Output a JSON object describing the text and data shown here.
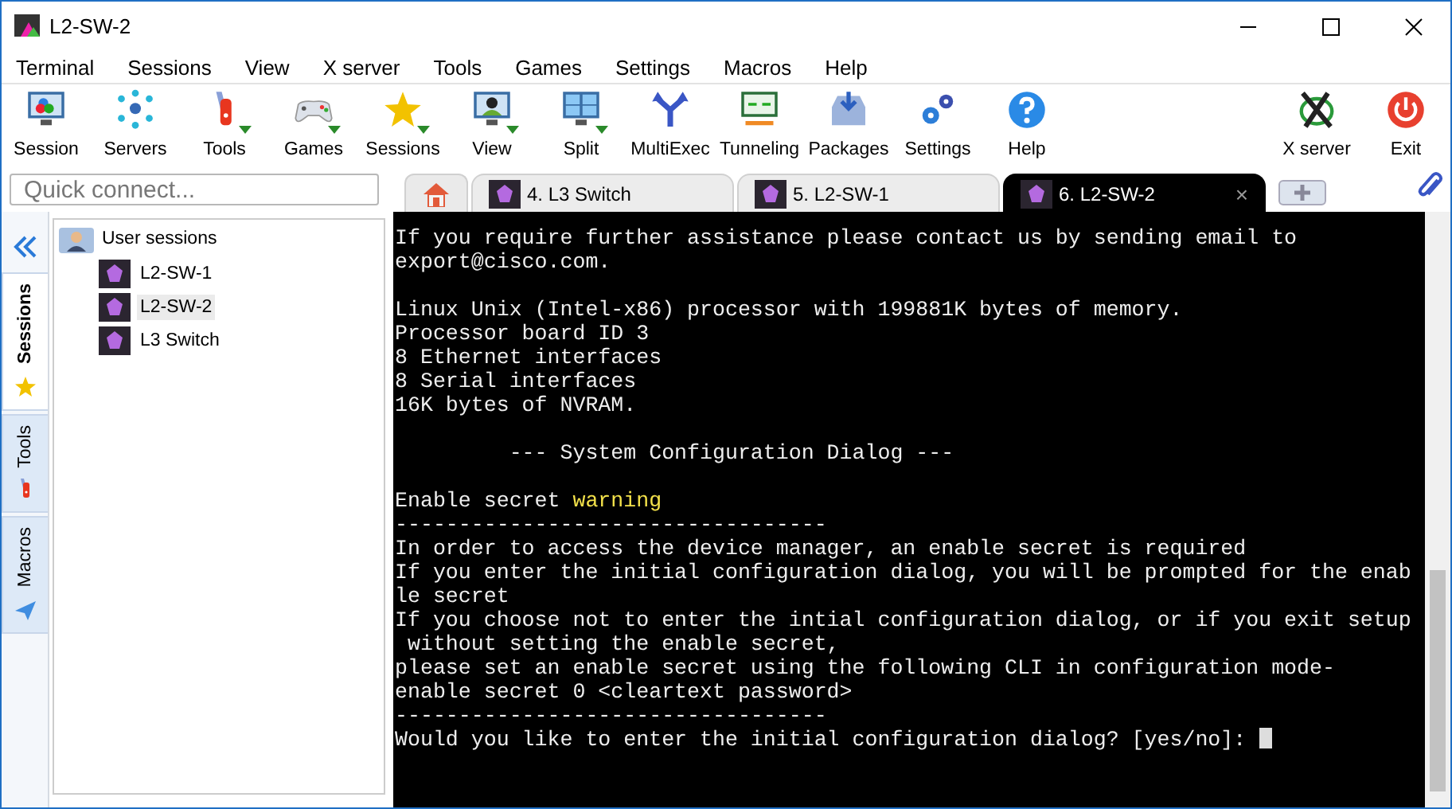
{
  "window": {
    "title": "L2-SW-2"
  },
  "menu": [
    "Terminal",
    "Sessions",
    "View",
    "X server",
    "Tools",
    "Games",
    "Settings",
    "Macros",
    "Help"
  ],
  "toolbar": [
    {
      "label": "Session",
      "kind": "session",
      "dropdown": false
    },
    {
      "label": "Servers",
      "kind": "servers",
      "dropdown": false
    },
    {
      "label": "Tools",
      "kind": "tools",
      "dropdown": true
    },
    {
      "label": "Games",
      "kind": "games",
      "dropdown": true
    },
    {
      "label": "Sessions",
      "kind": "star",
      "dropdown": true
    },
    {
      "label": "View",
      "kind": "view",
      "dropdown": true
    },
    {
      "label": "Split",
      "kind": "split",
      "dropdown": true
    },
    {
      "label": "MultiExec",
      "kind": "fork",
      "dropdown": false
    },
    {
      "label": "Tunneling",
      "kind": "tunnel",
      "dropdown": false
    },
    {
      "label": "Packages",
      "kind": "packages",
      "dropdown": false
    },
    {
      "label": "Settings",
      "kind": "gears",
      "dropdown": false
    },
    {
      "label": "Help",
      "kind": "help",
      "dropdown": false
    }
  ],
  "toolbar_right": [
    {
      "label": "X server",
      "kind": "xserver"
    },
    {
      "label": "Exit",
      "kind": "exit"
    }
  ],
  "quick_connect": {
    "placeholder": "Quick connect..."
  },
  "tabs": [
    {
      "label": "4. L3 Switch",
      "selected": false
    },
    {
      "label": "5. L2-SW-1",
      "selected": false
    },
    {
      "label": "6. L2-SW-2",
      "selected": true,
      "close": "×"
    }
  ],
  "side_tabs": [
    {
      "label": "Sessions",
      "kind": "star",
      "selected": true
    },
    {
      "label": "Tools",
      "kind": "tools",
      "selected": false
    },
    {
      "label": "Macros",
      "kind": "plane",
      "selected": false
    }
  ],
  "tree": {
    "label": "User sessions",
    "children": [
      {
        "label": "L2-SW-1",
        "selected": false
      },
      {
        "label": "L2-SW-2",
        "selected": true
      },
      {
        "label": "L3 Switch",
        "selected": false
      }
    ]
  },
  "terminal": {
    "blocks": [
      {
        "kind": "output",
        "lines": [
          {
            "segments": [
              {
                "text": "If you require further assistance please contact us by sending email to"
              }
            ]
          },
          {
            "segments": [
              {
                "text": "export@cisco.com."
              }
            ]
          }
        ]
      },
      {
        "kind": "output",
        "lines": [
          {
            "segments": [
              {
                "text": "Linux Unix (Intel-x86) processor with 199881K bytes of memory."
              }
            ]
          },
          {
            "segments": [
              {
                "text": "Processor board ID 3"
              }
            ]
          },
          {
            "segments": [
              {
                "text": "8 Ethernet interfaces"
              }
            ]
          },
          {
            "segments": [
              {
                "text": "8 Serial interfaces"
              }
            ]
          },
          {
            "segments": [
              {
                "text": "16K bytes of NVRAM."
              }
            ]
          }
        ]
      },
      {
        "kind": "heading",
        "lines": [
          {
            "segments": [
              {
                "text": "         --- System Configuration Dialog ---"
              }
            ]
          }
        ]
      },
      {
        "kind": "output",
        "lines": [
          {
            "segments": [
              {
                "text": "Enable secret "
              },
              {
                "text": "warning",
                "kind": "warning"
              }
            ]
          },
          {
            "segments": [
              {
                "text": "----------------------------------"
              }
            ]
          },
          {
            "segments": [
              {
                "text": "In order to access the device manager, an enable secret is required"
              }
            ]
          },
          {
            "segments": [
              {
                "text": "If you enter the initial configuration dialog, you will be prompted for the enab"
              }
            ]
          },
          {
            "segments": [
              {
                "text": "le secret"
              }
            ]
          },
          {
            "segments": [
              {
                "text": "If you choose not to enter the intial configuration dialog, or if you exit setup"
              }
            ]
          },
          {
            "segments": [
              {
                "text": " without setting the enable secret,"
              }
            ]
          },
          {
            "segments": [
              {
                "text": "please set an enable secret using the following CLI in configuration mode-"
              }
            ]
          },
          {
            "segments": [
              {
                "text": "enable secret 0 <cleartext password>"
              }
            ]
          },
          {
            "segments": [
              {
                "text": "----------------------------------"
              }
            ]
          },
          {
            "segments": [
              {
                "text": "Would you like to enter the initial configuration dialog? [yes/no]: "
              }
            ],
            "cursor": true
          }
        ]
      }
    ]
  }
}
